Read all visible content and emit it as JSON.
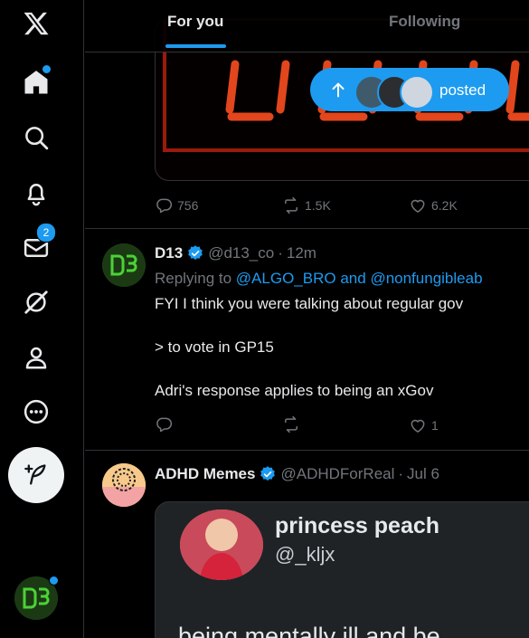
{
  "tabs": {
    "for_you": "For you",
    "following": "Following"
  },
  "nav": {
    "messages_badge": "2"
  },
  "top_tweet": {
    "replies": "756",
    "reposts": "1.5K",
    "likes": "6.2K"
  },
  "new_posts_pill": {
    "label": "posted"
  },
  "tweet1": {
    "name": "D13",
    "handle": "@d13_co",
    "sep": "·",
    "time": "12m",
    "replying_prefix": "Replying to",
    "replying_user1": "@ALGO_BRO",
    "replying_and": "and",
    "replying_user2": "@nonfungibleab",
    "line1": "FYI I think you were talking about regular gov",
    "line2": "> to vote in GP15",
    "line3": "Adri's response applies to being an xGov",
    "likes": "1"
  },
  "tweet2": {
    "name": "ADHD Memes",
    "handle": "@ADHDForReal",
    "sep": "·",
    "time": "Jul 6",
    "embedded_name": "princess peach",
    "embedded_handle": "@_kljx",
    "embedded_text": "being mentally ill and be"
  },
  "colors": {
    "accent": "#1d9bf0",
    "background": "#000000",
    "muted": "#71767b",
    "text": "#e7e9ea"
  }
}
